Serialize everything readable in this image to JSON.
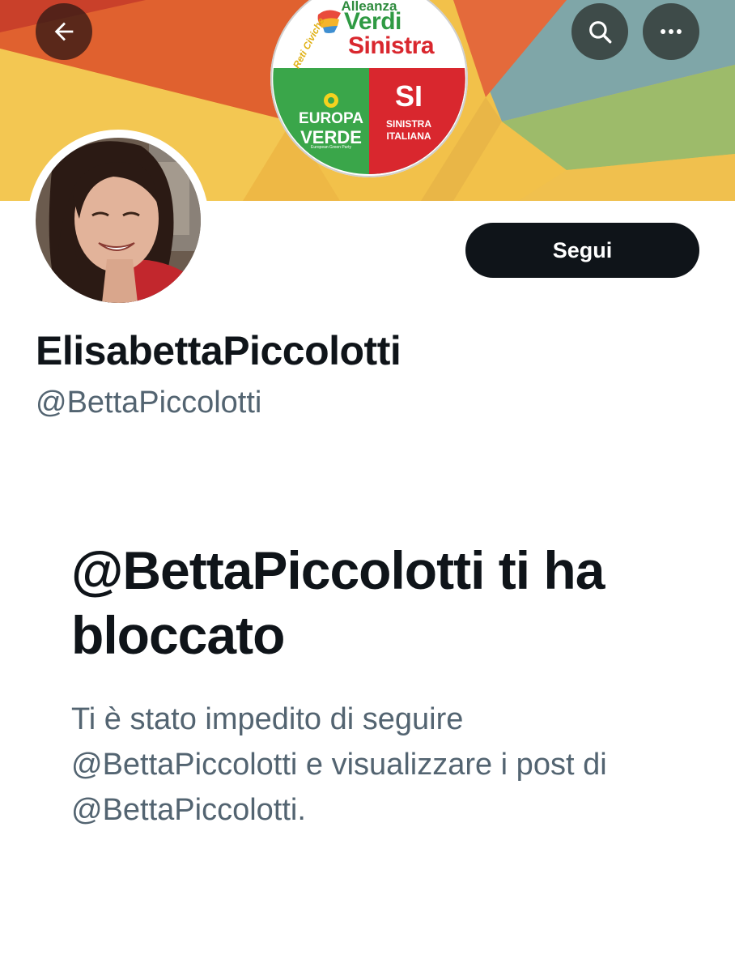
{
  "header": {
    "back_icon": "arrow-left-icon",
    "search_icon": "search-icon",
    "more_icon": "more-horizontal-icon"
  },
  "banner_logo": {
    "line1": "Alleanza",
    "line2": "Verdi",
    "line3": "Sinistra",
    "side_text": "Reti Civiche",
    "left_top": "EUROPA",
    "left_bottom": "VERDE",
    "left_small": "European Green Party",
    "right_symbol": "SI",
    "right_line1": "SINISTRA",
    "right_line2": "ITALIANA",
    "colors": {
      "green": "#2f9a43",
      "red": "#d9272e"
    }
  },
  "profile": {
    "display_name": "ElisabettaPiccolotti",
    "handle": "@BettaPiccolotti",
    "follow_label": "Segui"
  },
  "blocked": {
    "title": "@BettaPiccolotti ti ha bloccato",
    "description": "Ti è stato impedito di seguire @BettaPiccolotti e visualizzare i post di @BettaPiccolotti."
  },
  "colors": {
    "primary_text": "#0f1419",
    "secondary_text": "#536471",
    "button_bg": "#0f1419"
  }
}
